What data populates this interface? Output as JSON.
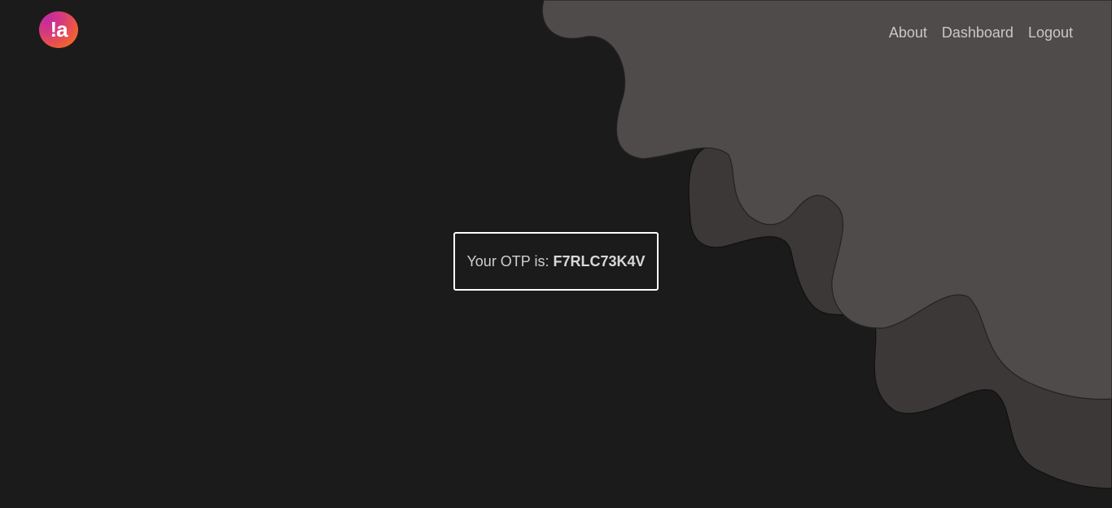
{
  "header": {
    "logo_text": "!a"
  },
  "nav": {
    "items": [
      {
        "label": "About"
      },
      {
        "label": "Dashboard"
      },
      {
        "label": "Logout"
      }
    ]
  },
  "otp": {
    "prefix": "Your OTP is: ",
    "code": "F7RLC73K4V"
  },
  "colors": {
    "background": "#1b1b1b",
    "blob_light": "#4f4b4a",
    "blob_dark": "#3b3837",
    "text": "#c8c8c8",
    "otp_border": "#ffffff"
  }
}
